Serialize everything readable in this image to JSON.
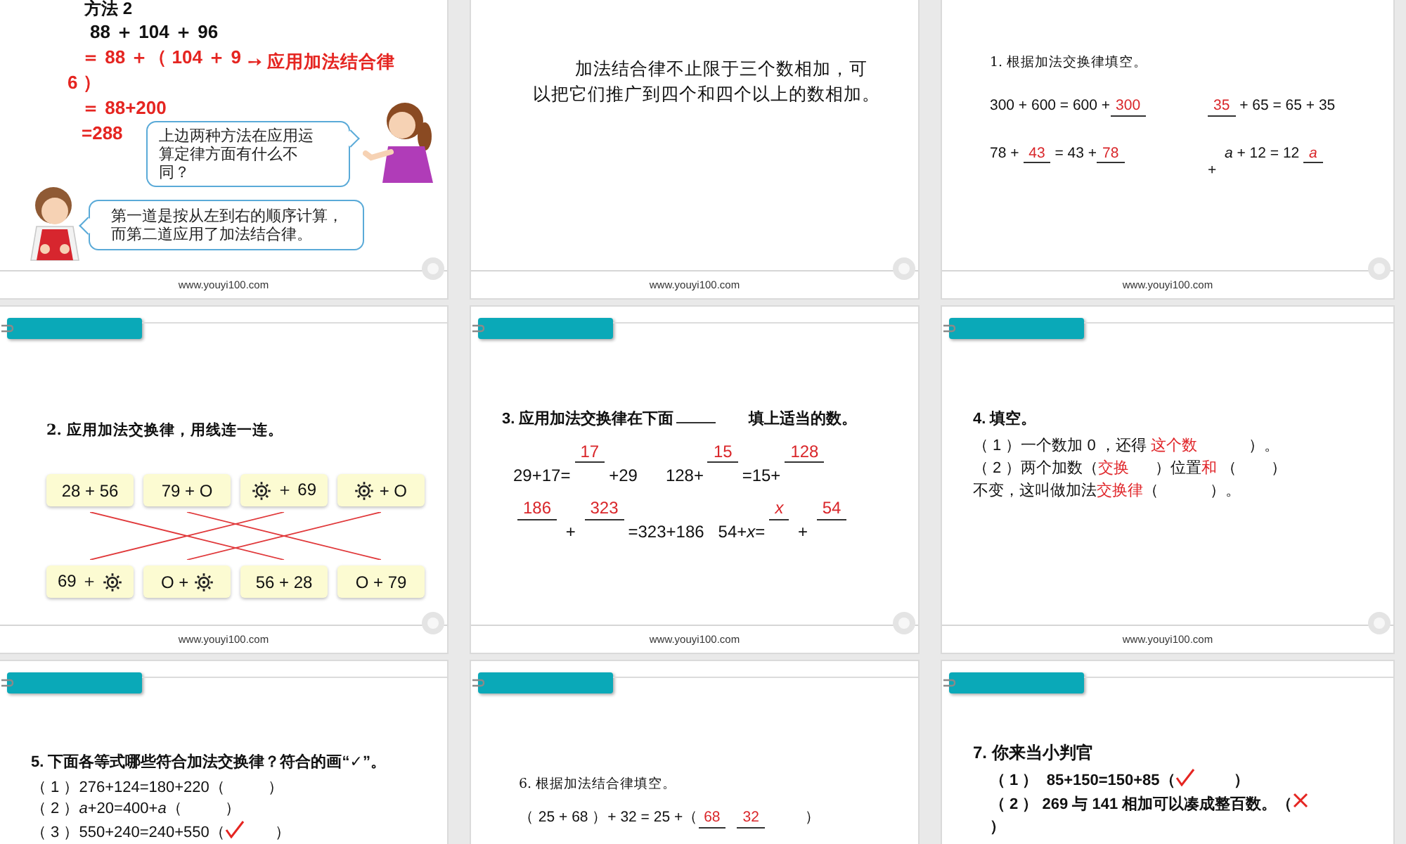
{
  "slides": [
    {
      "kind": "worked-example",
      "header_tab": false,
      "heading": "方法 2",
      "steps": [
        {
          "kind": "given",
          "text": "88 ＋ 104 ＋ 96"
        },
        {
          "kind": "step",
          "text": "＝ 88 ＋（ 104 ＋ 9"
        },
        {
          "kind": "continued",
          "text": "6 ）"
        },
        {
          "kind": "step",
          "text": "＝ 88+200"
        },
        {
          "kind": "step",
          "text": "=288"
        }
      ],
      "note": "➙ 应用加法结合律",
      "bubbles": [
        {
          "kind": "teacher",
          "lines": [
            "上边两种方法在应用运",
            "算定律方面有什么不",
            "同？"
          ]
        },
        {
          "kind": "student",
          "lines": [
            "第一道是按从左到右的顺序计算，",
            "而第二道应用了加法结合律。"
          ]
        }
      ],
      "footer": "www.youyi100.com"
    },
    {
      "kind": "statement",
      "header_tab": false,
      "lines": [
        "加法结合律不止限于三个数相加，可",
        "以把它们推广到四个和四个以上的数相加。"
      ],
      "footer": "www.youyi100.com"
    },
    {
      "kind": "fill-in",
      "header_tab": false,
      "title": "1. 根据加法交换律填空。",
      "rows": [
        {
          "groups": [
            [
              {
                "kind": "text",
                "text": "300 + 600 = 600 +"
              },
              {
                "kind": "blank",
                "text": "300"
              }
            ],
            [
              {
                "kind": "blank",
                "text": "35"
              },
              {
                "kind": "text",
                "text": " + 65 = 65 + 35"
              }
            ]
          ]
        },
        {
          "groups": [
            [
              {
                "kind": "text",
                "text": "78 + "
              },
              {
                "kind": "blank",
                "text": "43"
              },
              {
                "kind": "text",
                "text": " = 43 +"
              },
              {
                "kind": "blank",
                "text": "78"
              }
            ],
            [
              {
                "kind": "low",
                "text": "+"
              },
              {
                "kind": "text",
                "text": "  *a* + 12 = 12 "
              },
              {
                "kind": "blank",
                "text": "a",
                "italic": true
              }
            ]
          ]
        }
      ],
      "footer": "www.youyi100.com"
    },
    {
      "kind": "matching",
      "header_tab": true,
      "title": "2. 应用加法交换律，用线连一连。",
      "top": [
        {
          "parts": [
            {
              "kind": "text",
              "text": "28 + 56"
            }
          ]
        },
        {
          "parts": [
            {
              "kind": "text",
              "text": "79 + O"
            }
          ]
        },
        {
          "parts": [
            {
              "kind": "symbol"
            },
            {
              "kind": "text",
              "text": " ＋ 69"
            }
          ]
        },
        {
          "parts": [
            {
              "kind": "symbol"
            },
            {
              "kind": "text",
              "text": " + O"
            }
          ]
        }
      ],
      "bottom": [
        {
          "parts": [
            {
              "kind": "text",
              "text": "69 ＋ "
            },
            {
              "kind": "symbol"
            }
          ]
        },
        {
          "parts": [
            {
              "kind": "text",
              "text": "O + "
            },
            {
              "kind": "symbol"
            }
          ]
        },
        {
          "parts": [
            {
              "kind": "text",
              "text": "56 + 28"
            }
          ]
        },
        {
          "parts": [
            {
              "kind": "text",
              "text": "O + 79"
            }
          ]
        }
      ],
      "footer": "www.youyi100.com"
    },
    {
      "kind": "practice",
      "header_tab": true,
      "title_parts": [
        {
          "kind": "text",
          "text": "3. 应用加法交换律在下面"
        },
        {
          "kind": "line"
        },
        {
          "kind": "text",
          "text": "       填上适当的数。"
        }
      ],
      "rows": [
        {
          "groups": [
            [
              {
                "kind": "text",
                "text": "29+17="
              },
              {
                "kind": "raised",
                "text": "17"
              },
              {
                "kind": "text",
                "text": "+29      128+"
              },
              {
                "kind": "raised",
                "text": "15"
              },
              {
                "kind": "text",
                "text": "=15+"
              },
              {
                "kind": "raised",
                "text": "128"
              }
            ]
          ]
        },
        {
          "groups": [
            [
              {
                "kind": "raised",
                "text": "186"
              },
              {
                "kind": "text",
                "text": " + "
              },
              {
                "kind": "raised",
                "text": "323"
              },
              {
                "kind": "text",
                "text": "=323+186   54+*x*="
              },
              {
                "kind": "raised",
                "text": "x",
                "italic": true
              },
              {
                "kind": "text",
                "text": " + "
              },
              {
                "kind": "raised",
                "text": "54"
              }
            ]
          ]
        }
      ],
      "footer": "www.youyi100.com"
    },
    {
      "kind": "practice",
      "header_tab": true,
      "title_parts": [
        {
          "kind": "text",
          "text": "4. 填空。"
        }
      ],
      "rows": [
        {
          "groups": [
            [
              {
                "kind": "text",
                "text": "（ 1 ）一个数加 0 ，还得 "
              },
              {
                "kind": "answer",
                "text": "这个数"
              },
              {
                "kind": "text",
                "text": "            ）。"
              }
            ]
          ]
        },
        {
          "groups": [
            [
              {
                "kind": "text",
                "text": "（ 2 ）两个加数（"
              },
              {
                "kind": "answer",
                "text": "交换"
              },
              {
                "kind": "text",
                "text": "      ）位置"
              },
              {
                "kind": "answer",
                "text": "和"
              },
              {
                "kind": "text",
                "text": " （        ）"
              }
            ]
          ]
        },
        {
          "groups": [
            [
              {
                "kind": "text",
                "text": "不变，这叫做加法"
              },
              {
                "kind": "answer",
                "text": "交换律"
              },
              {
                "kind": "text",
                "text": "（            ）。"
              }
            ]
          ]
        }
      ],
      "footer": "www.youyi100.com"
    },
    {
      "kind": "practice",
      "header_tab": true,
      "title_parts": [
        {
          "kind": "text",
          "text": "5. 下面各等式哪些符合加法交换律？符合的画“✓”。"
        }
      ],
      "rows": [
        {
          "groups": [
            [
              {
                "kind": "text",
                "text": "（ 1 ）276+124=180+220（          ）"
              }
            ]
          ]
        },
        {
          "groups": [
            [
              {
                "kind": "text",
                "text": "（ 2 ）*a*+20=400+*a*（          ）"
              }
            ]
          ]
        },
        {
          "groups": [
            [
              {
                "kind": "text",
                "text": "（ 3 ）550+240=240+550（"
              },
              {
                "kind": "check"
              },
              {
                "kind": "text",
                "text": "       ）"
              }
            ]
          ]
        }
      ]
    },
    {
      "kind": "fill-in",
      "header_tab": true,
      "title": "6. 根据加法结合律填空。",
      "rows": [
        {
          "groups": [
            [
              {
                "kind": "text",
                "text": "（ 25 + 68 ）+ 32 = 25 +（"
              },
              {
                "kind": "blank",
                "text": "68"
              },
              {
                "kind": "blank",
                "text": "32"
              },
              {
                "kind": "text",
                "text": "       ）"
              }
            ]
          ]
        }
      ]
    },
    {
      "kind": "practice",
      "header_tab": true,
      "title_parts": [
        {
          "kind": "text",
          "text": "7. 你来当小判官"
        }
      ],
      "rows": [
        {
          "groups": [
            [
              {
                "kind": "text",
                "text": "（ 1 ）  85+150=150+85（"
              },
              {
                "kind": "check"
              },
              {
                "kind": "text",
                "text": "         ）"
              }
            ]
          ]
        },
        {
          "groups": [
            [
              {
                "kind": "text",
                "text": "（ 2 ） 269 与 141 相加可以凑成整百数。（"
              },
              {
                "kind": "cross"
              }
            ]
          ]
        },
        {
          "groups": [
            [
              {
                "kind": "text",
                "text": "）"
              }
            ]
          ]
        }
      ]
    }
  ]
}
